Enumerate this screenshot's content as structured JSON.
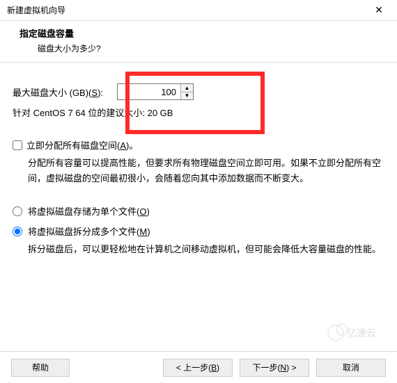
{
  "window": {
    "title": "新建虚拟机向导",
    "close_label": "✕"
  },
  "header": {
    "title": "指定磁盘容量",
    "subtitle": "磁盘大小为多少?"
  },
  "disk": {
    "label_prefix": "最大磁盘大小 (GB)(",
    "label_hotkey": "S",
    "label_suffix": "):",
    "value": "100",
    "recommend": "针对 CentOS 7 64 位的建议大小: 20 GB"
  },
  "allocate": {
    "label_prefix": "立即分配所有磁盘空间(",
    "label_hotkey": "A",
    "label_suffix": ")。",
    "desc": "分配所有容量可以提高性能，但要求所有物理磁盘空间立即可用。如果不立即分配所有空间，虚拟磁盘的空间最初很小，会随着您向其中添加数据而不断变大。"
  },
  "split": {
    "single_prefix": "将虚拟磁盘存储为单个文件(",
    "single_hotkey": "O",
    "single_suffix": ")",
    "multi_prefix": "将虚拟磁盘拆分成多个文件(",
    "multi_hotkey": "M",
    "multi_suffix": ")",
    "desc": "拆分磁盘后，可以更轻松地在计算机之间移动虚拟机，但可能会降低大容量磁盘的性能。"
  },
  "buttons": {
    "help": "帮助",
    "back_prefix": "< 上一步(",
    "back_hotkey": "B",
    "back_suffix": ")",
    "next_prefix": "下一步(",
    "next_hotkey": "N",
    "next_suffix": ") >",
    "cancel": "取消"
  },
  "watermark": "亿速云"
}
